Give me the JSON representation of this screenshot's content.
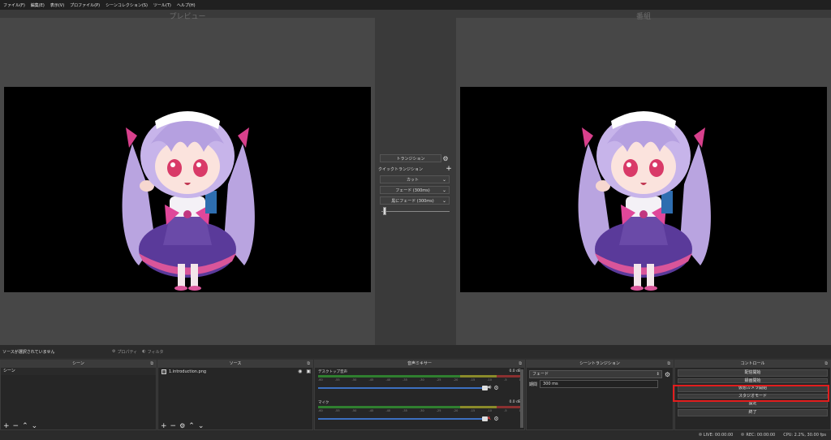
{
  "menu": [
    "ファイル(F)",
    "編集(E)",
    "表示(V)",
    "プロファイル(P)",
    "シーンコレクション(S)",
    "ツール(T)",
    "ヘルプ(H)"
  ],
  "preview": {
    "title": "プレビュー"
  },
  "program": {
    "title": "番組"
  },
  "transitions": {
    "button": "トランジション",
    "quick_label": "クイックトランジション",
    "items": [
      "カット",
      "フェード (300ms)",
      "黒にフェード (300ms)"
    ]
  },
  "sourcebar": {
    "no_source": "ソースが選択されていません",
    "properties": "プロパティ",
    "filters": "フィルタ"
  },
  "scenes": {
    "title": "シーン",
    "items": [
      "シーン"
    ]
  },
  "sources": {
    "title": "ソース",
    "items": [
      "1.introduction.png"
    ]
  },
  "mixer": {
    "title": "音声ミキサー",
    "channels": [
      {
        "name": "デスクトップ音声",
        "level": "0.0 dB",
        "muted": false
      },
      {
        "name": "マイク",
        "level": "0.0 dB",
        "muted": true
      }
    ],
    "scale": [
      "-60",
      "-55",
      "-50",
      "-45",
      "-40",
      "-35",
      "-30",
      "-25",
      "-20",
      "-15",
      "-10",
      "-5",
      "0"
    ]
  },
  "scene_transitions": {
    "title": "シーントランジション",
    "selected": "フェード",
    "duration_label": "期間",
    "duration": "300 ms"
  },
  "controls": {
    "title": "コントロール",
    "buttons": [
      "配信開始",
      "録画開始",
      "仮想カメラ開始",
      "スタジオモード",
      "設定",
      "終了"
    ]
  },
  "status": {
    "live": "LIVE: 00:00:00",
    "rec": "REC: 00:00:00",
    "cpu": "CPU: 2.2%, 30.00 fps"
  },
  "colors": {
    "highlight": "#e21d1d",
    "mute": "#e24040"
  }
}
